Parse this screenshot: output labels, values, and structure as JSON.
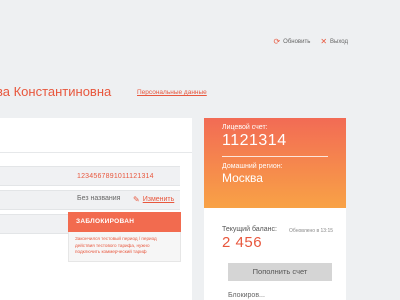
{
  "header": {
    "refresh_label": "Обновить",
    "logout_label": "Выход",
    "refresh_icon": "refresh-icon",
    "close_icon": "close-icon"
  },
  "user": {
    "name": "ва Константиновна",
    "personal_data_link": "Персональные данные"
  },
  "plan": {
    "account_number": "1234567891011121314",
    "plan_name": "Без названия",
    "edit_label": "Изменить",
    "status": "ЗАБЛОКИРОВАН",
    "status_note": "Закончился тестовый период / период действия тестового тарифа, нужно подключить коммерческий тариф"
  },
  "account": {
    "account_label": "Лицевой счет:",
    "account_value": "1121314",
    "region_label": "Домашний регион:",
    "region_value": "Москва"
  },
  "balance": {
    "label": "Текущий баланс:",
    "updated": "Обновлено в 13:15",
    "value": "2 456",
    "topup_button": "Пополнить счет",
    "cut_text": "Блокиров..."
  },
  "colors": {
    "accent": "#e8573d",
    "gradient_top": "#f26b55",
    "gradient_bottom": "#f8a246",
    "background": "#eef0f2"
  }
}
